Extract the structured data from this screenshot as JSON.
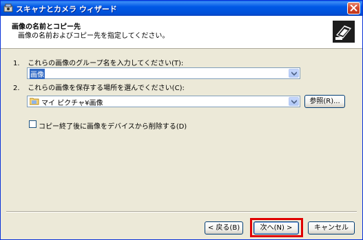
{
  "window": {
    "title": "スキャナとカメラ ウィザード"
  },
  "header": {
    "title": "画像の名前とコピー先",
    "subtitle": "画像の名前およびコピー先を指定してください。"
  },
  "step1": {
    "number": "1.",
    "label": "これらの画像のグループ名を入力してください(T):",
    "value": "画像"
  },
  "step2": {
    "number": "2.",
    "label": "これらの画像を保存する場所を選んでください(C):",
    "value": "マイ ピクチャ¥画像",
    "browse_label": "参照(R)..."
  },
  "option": {
    "delete_after_copy_label": "コピー終了後に画像をデバイスから削除する(D)",
    "checked": false
  },
  "footer": {
    "back_label": "< 戻る(B)",
    "next_label": "次へ(N) >",
    "cancel_label": "キャンセル"
  },
  "colors": {
    "titlebar": "#0058e6",
    "highlight": "#e00000",
    "dialog_bg": "#ece9d8"
  },
  "icons": {
    "title": "scanner-camera-icon",
    "header": "scanner-wizard-icon",
    "close": "close-icon",
    "dropdown": "chevron-down-icon",
    "folder": "folder-icon"
  }
}
